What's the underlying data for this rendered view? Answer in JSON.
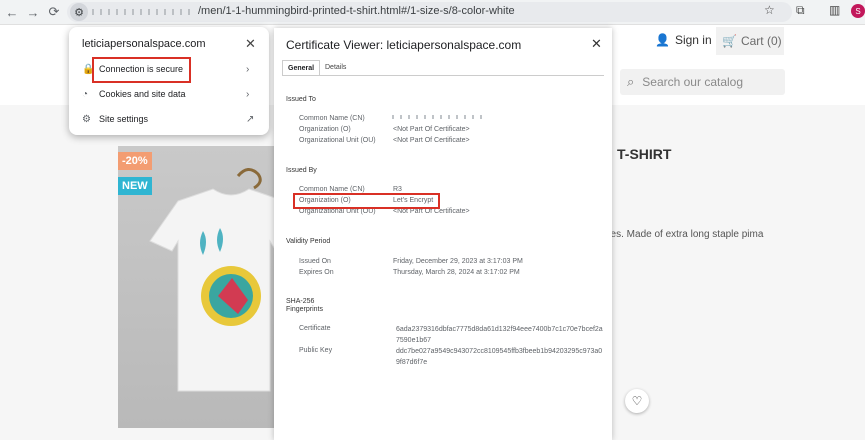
{
  "browser": {
    "url_path": "/men/1-1-hummingbird-printed-t-shirt.html#/1-size-s/8-color-white",
    "profile_initial": "S"
  },
  "shop": {
    "sign_in": "Sign in",
    "cart": "Cart (0)",
    "search_placeholder": "Search our catalog",
    "discount_badge": "-20%",
    "new_badge": "NEW",
    "product_title_partial": "T-SHIRT",
    "product_desc_partial": "eves. Made of extra long staple pima"
  },
  "site_info": {
    "host": "leticiapersonalspace.com",
    "items": [
      {
        "label": "Connection is secure",
        "icon": "lock-icon"
      },
      {
        "label": "Cookies and site data",
        "icon": "cookie-icon"
      },
      {
        "label": "Site settings",
        "icon": "gear-icon"
      }
    ]
  },
  "certificate": {
    "title": "Certificate Viewer: leticiapersonalspace.com",
    "tabs": [
      "General",
      "Details"
    ],
    "issued_to": {
      "heading": "Issued To",
      "rows": [
        {
          "key": "Common Name (CN)",
          "value": ""
        },
        {
          "key": "Organization (O)",
          "value": "<Not Part Of Certificate>"
        },
        {
          "key": "Organizational Unit (OU)",
          "value": "<Not Part Of Certificate>"
        }
      ]
    },
    "issued_by": {
      "heading": "Issued By",
      "rows": [
        {
          "key": "Common Name (CN)",
          "value": "R3"
        },
        {
          "key": "Organization (O)",
          "value": "Let's Encrypt"
        },
        {
          "key": "Organizational Unit (OU)",
          "value": "<Not Part Of Certificate>"
        }
      ]
    },
    "validity": {
      "heading": "Validity Period",
      "rows": [
        {
          "key": "Issued On",
          "value": "Friday, December 29, 2023 at 3:17:03 PM"
        },
        {
          "key": "Expires On",
          "value": "Thursday, March 28, 2024 at 3:17:02 PM"
        }
      ]
    },
    "fingerprints": {
      "heading_line1": "SHA-256",
      "heading_line2": "Fingerprints",
      "rows": [
        {
          "key": "Certificate",
          "value": "6ada2379316dbfac7775d8da61d132f94eee7400b7c1c70e7bcef2a7590e1b67"
        },
        {
          "key": "Public Key",
          "value": "ddc7be027a9549c943072cc8109545ffb3fbeeb1b94203295c973a09f87d6f7e"
        }
      ]
    }
  },
  "colors": {
    "highlight": "#d93025",
    "discount": "#f39d72",
    "new": "#2fb5d2"
  }
}
